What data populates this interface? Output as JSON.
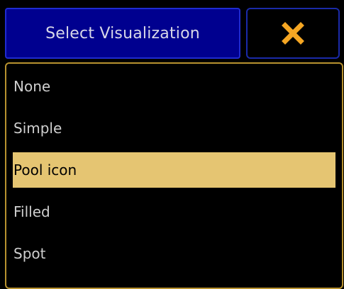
{
  "header": {
    "title": "Select Visualization",
    "close_icon": "close-x-icon",
    "close_color": "#f5a623"
  },
  "list": {
    "selected_index": 2,
    "items": [
      {
        "label": "None"
      },
      {
        "label": "Simple"
      },
      {
        "label": "Pool icon"
      },
      {
        "label": "Filled"
      },
      {
        "label": "Spot"
      }
    ]
  },
  "colors": {
    "title_bg": "#00008f",
    "panel_border": "#b8922f",
    "selected_bg": "#e5c572"
  }
}
